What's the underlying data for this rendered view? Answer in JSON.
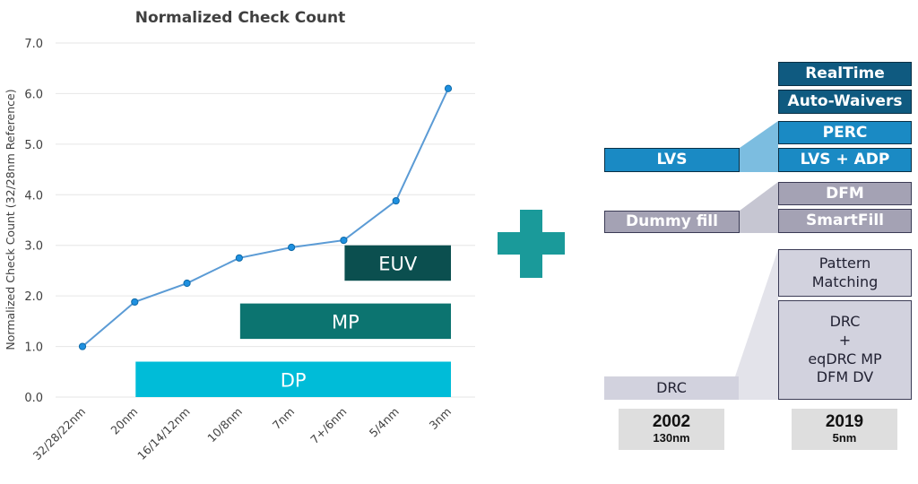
{
  "chart_data": {
    "type": "line",
    "title": "Normalized Check Count",
    "xlabel": "",
    "ylabel": "Normalized Check Count (32/28nm Reference)",
    "categories": [
      "32/28/22nm",
      "20nm",
      "16/14/12nm",
      "10/8nm",
      "7nm",
      "7+/6nm",
      "5/4nm",
      "3nm"
    ],
    "series": [
      {
        "name": "Normalized Check Count",
        "values": [
          1.0,
          1.88,
          2.25,
          2.75,
          2.96,
          3.1,
          3.88,
          6.1
        ],
        "color": "#5b9bd5"
      }
    ],
    "ylim": [
      0,
      7
    ],
    "yticks": [
      "0.0",
      "1.0",
      "2.0",
      "3.0",
      "4.0",
      "5.0",
      "6.0",
      "7.0"
    ],
    "grid": true,
    "legend": "none",
    "bands": [
      {
        "label": "DP",
        "from": "20nm",
        "to": "3nm",
        "ymin": 0.0,
        "ymax": 0.7,
        "color": "#00bcd8"
      },
      {
        "label": "MP",
        "from": "10/8nm",
        "to": "3nm",
        "ymin": 1.15,
        "ymax": 1.85,
        "color": "#0c7470"
      },
      {
        "label": "EUV",
        "from": "7+/6nm",
        "to": "3nm",
        "ymin": 2.3,
        "ymax": 3.0,
        "color": "#0b4f4f"
      }
    ]
  },
  "plus_sign": {
    "icon": "plus-icon",
    "color": "#1a9a9a"
  },
  "diagram": {
    "left_column": {
      "lvs": "LVS",
      "dummy_fill": "Dummy fill",
      "drc": "DRC"
    },
    "right_column": {
      "realtime": "RealTime",
      "auto_waivers": "Auto-Waivers",
      "perc": "PERC",
      "lvs_adp": "LVS + ADP",
      "dfm": "DFM",
      "smartfill": "SmartFill",
      "pattern_matching_1": "Pattern",
      "pattern_matching_2": "Matching",
      "drc_line1": "DRC",
      "drc_line2": "+",
      "drc_line3": "eqDRC MP",
      "drc_line4": "DFM DV"
    },
    "years": [
      {
        "year": "2002",
        "node": "130nm"
      },
      {
        "year": "2019",
        "node": "5nm"
      }
    ]
  }
}
